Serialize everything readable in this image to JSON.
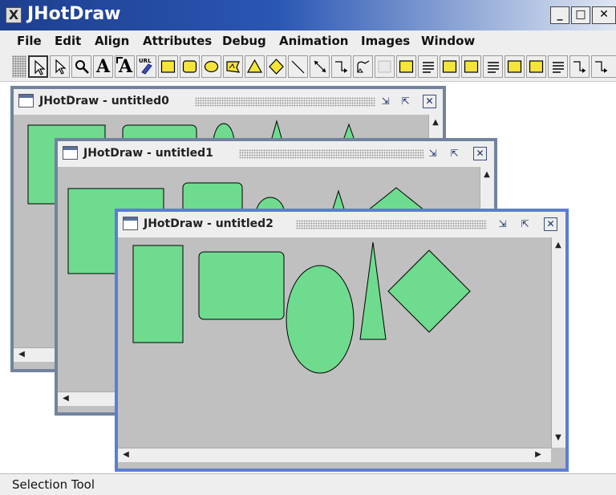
{
  "app": {
    "title": "JHotDraw",
    "icon": "x-app-icon",
    "minimize": "_",
    "maximize": "□",
    "close": "✕"
  },
  "menu": [
    "File",
    "Edit",
    "Align",
    "Attributes",
    "Debug",
    "Animation",
    "Images",
    "Window"
  ],
  "toolbar": {
    "selected": "selection-tool",
    "tools": [
      "selection-tool",
      "direct-selection-tool",
      "zoom-tool",
      "text-tool",
      "text-area-tool",
      "url-tool",
      "rectangle-tool",
      "round-rectangle-tool",
      "ellipse-tool",
      "image-tool",
      "triangle-tool",
      "diamond-tool",
      "line-tool",
      "connection-tool",
      "elbow-connection-tool",
      "curve-connection-tool",
      "border-tool",
      "fill-tool",
      "alignment-tool",
      "fill-tool-2",
      "fill-tool-3",
      "align-tool-2",
      "elbow-tool-2"
    ],
    "labels": {
      "text_tool": "A",
      "text_area_tool": "A",
      "url_tool": "URL"
    }
  },
  "windows": [
    {
      "title": "JHotDraw - untitled0",
      "active": false
    },
    {
      "title": "JHotDraw - untitled1",
      "active": false
    },
    {
      "title": "JHotDraw - untitled2",
      "active": true
    }
  ],
  "colors": {
    "figure_fill": "#6fdb8f",
    "canvas": "#c0c0c0",
    "active_border": "#5a7ed6",
    "inactive_border": "#71839e"
  },
  "status": {
    "text": "Selection Tool"
  }
}
